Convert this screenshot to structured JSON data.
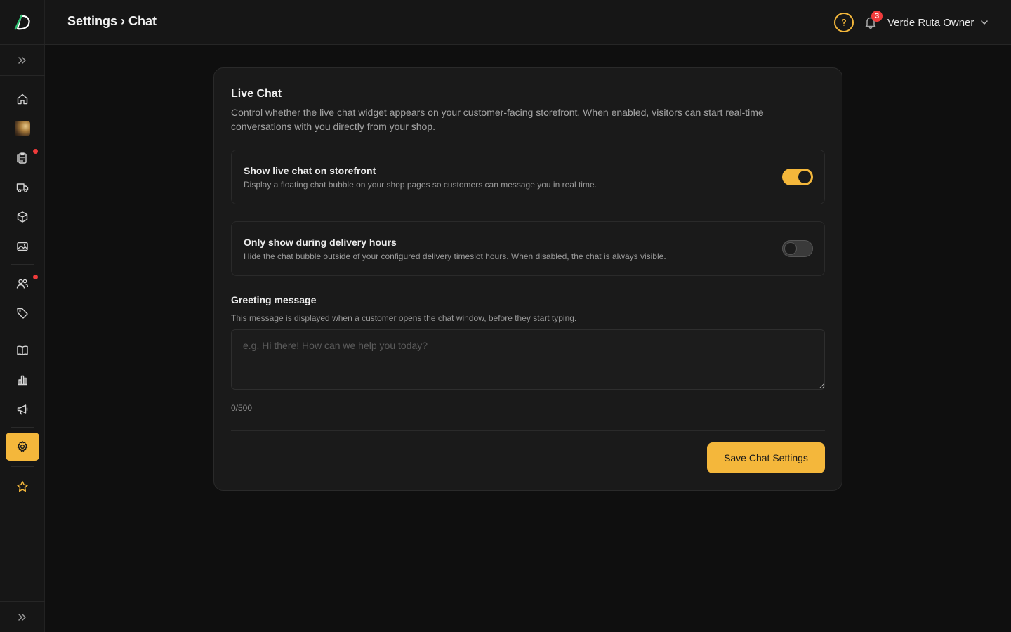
{
  "header": {
    "breadcrumb": "Settings › Chat",
    "notification_count": "3",
    "user_name": "Verde Ruta Owner"
  },
  "sidebar": {
    "items": [
      {
        "icon": "home-icon",
        "active": false,
        "dot": false
      },
      {
        "icon": "store-avatar",
        "active": false,
        "dot": false
      },
      {
        "icon": "orders-icon",
        "active": false,
        "dot": true
      },
      {
        "icon": "truck-icon",
        "active": false,
        "dot": false
      },
      {
        "icon": "box-icon",
        "active": false,
        "dot": false
      },
      {
        "icon": "image-icon",
        "active": false,
        "dot": false
      },
      {
        "icon": "users-icon",
        "active": false,
        "dot": true
      },
      {
        "icon": "tag-icon",
        "active": false,
        "dot": false
      },
      {
        "icon": "book-icon",
        "active": false,
        "dot": false
      },
      {
        "icon": "chart-icon",
        "active": false,
        "dot": false
      },
      {
        "icon": "megaphone-icon",
        "active": false,
        "dot": false
      },
      {
        "icon": "gear-icon",
        "active": true,
        "dot": false
      },
      {
        "icon": "star-icon",
        "active": false,
        "dot": false
      }
    ]
  },
  "card": {
    "title": "Live Chat",
    "description": "Control whether the live chat widget appears on your customer-facing storefront. When enabled, visitors can start real-time conversations with you directly from your shop.",
    "settings": [
      {
        "label": "Show live chat on storefront",
        "help": "Display a floating chat bubble on your shop pages so customers can message you in real time.",
        "enabled": true
      },
      {
        "label": "Only show during delivery hours",
        "help": "Hide the chat bubble outside of your configured delivery timeslot hours. When disabled, the chat is always visible.",
        "enabled": false
      }
    ],
    "greeting": {
      "label": "Greeting message",
      "help": "This message is displayed when a customer opens the chat window, before they start typing.",
      "value": "",
      "placeholder": "e.g. Hi there! How can we help you today?",
      "char_count": "0/500"
    },
    "save_label": "Save Chat Settings"
  },
  "colors": {
    "accent": "#f4b73b",
    "background": "#0f0f0f",
    "surface": "#1a1a1a",
    "badge": "#ef3b3b"
  }
}
